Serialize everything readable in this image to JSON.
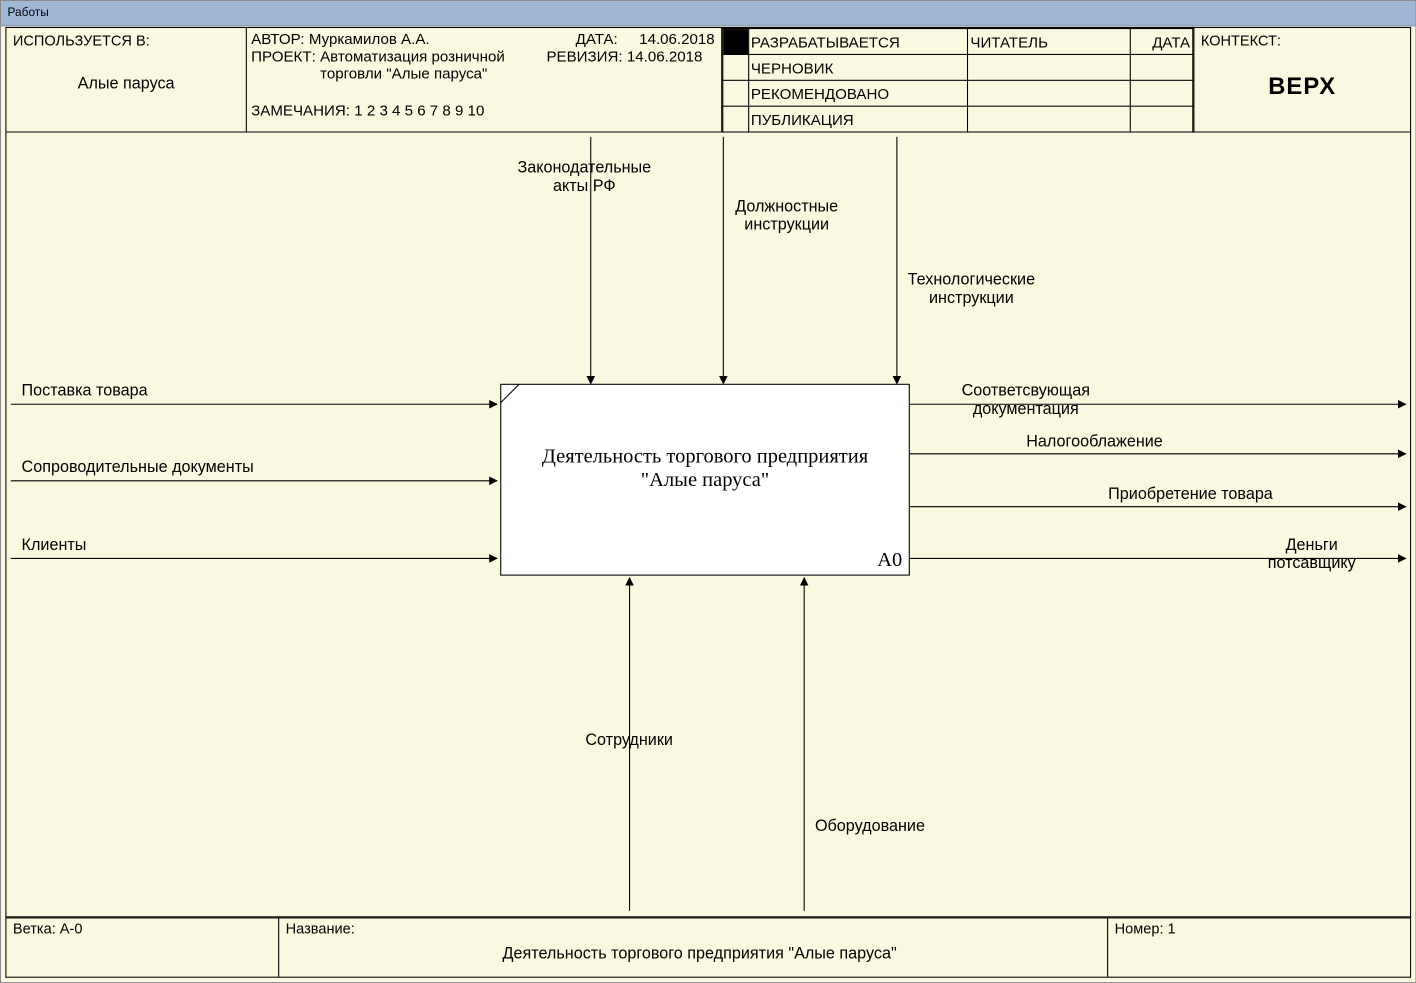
{
  "window": {
    "title": "Работы"
  },
  "header": {
    "used_in_label": "ИСПОЛЬЗУЕТСЯ В:",
    "used_in_value": "Алые паруса",
    "author_label": "АВТОР:",
    "author_value": "Муркамилов А.А.",
    "project_label": "ПРОЕКТ:",
    "project_value": "Автоматизация розничной торговли \"Алые паруса\"",
    "remarks_label": "ЗАМЕЧАНИЯ:",
    "remarks_value": "1 2 3 4 5 6 7 8 9 10",
    "date_label": "ДАТА:",
    "date_value": "14.06.2018",
    "rev_label": "РЕВИЗИЯ:",
    "rev_value": "14.06.2018",
    "status": {
      "working": "РАЗРАБАТЫВАЕТСЯ",
      "draft": "ЧЕРНОВИК",
      "recommended": "РЕКОМЕНДОВАНО",
      "publication": "ПУБЛИКАЦИЯ"
    },
    "reader_label": "ЧИТАТЕЛЬ",
    "hdr_date_label": "ДАТА",
    "context_label": "КОНТЕКСТ:",
    "context_value": "ВЕРХ"
  },
  "footer": {
    "node_label": "Ветка:",
    "node_value": "A-0",
    "title_label": "Название:",
    "title_value": "Деятельность торгового предприятия \"Алые паруса\"",
    "number_label": "Номер:",
    "number_value": "1"
  },
  "diagram": {
    "activity_title_l1": "Деятельность торгового предприятия",
    "activity_title_l2": "\"Алые паруса\"",
    "activity_node": "A0",
    "controls": {
      "law": "Законодательные\nакты РФ",
      "job": "Должностные\nинструкции",
      "tech": "Технологические\nинструкции"
    },
    "inputs": {
      "supply": "Поставка товара",
      "docs": "Сопроводительные документы",
      "clients": "Клиенты"
    },
    "outputs": {
      "doc": "Соответсвующая\nдокументация",
      "tax": "Налогооблажение",
      "purchase": "Приобретение товара",
      "money": "Деньги\nпотсавщику"
    },
    "mechanisms": {
      "staff": "Сотрудники",
      "equip": "Оборудование"
    }
  }
}
